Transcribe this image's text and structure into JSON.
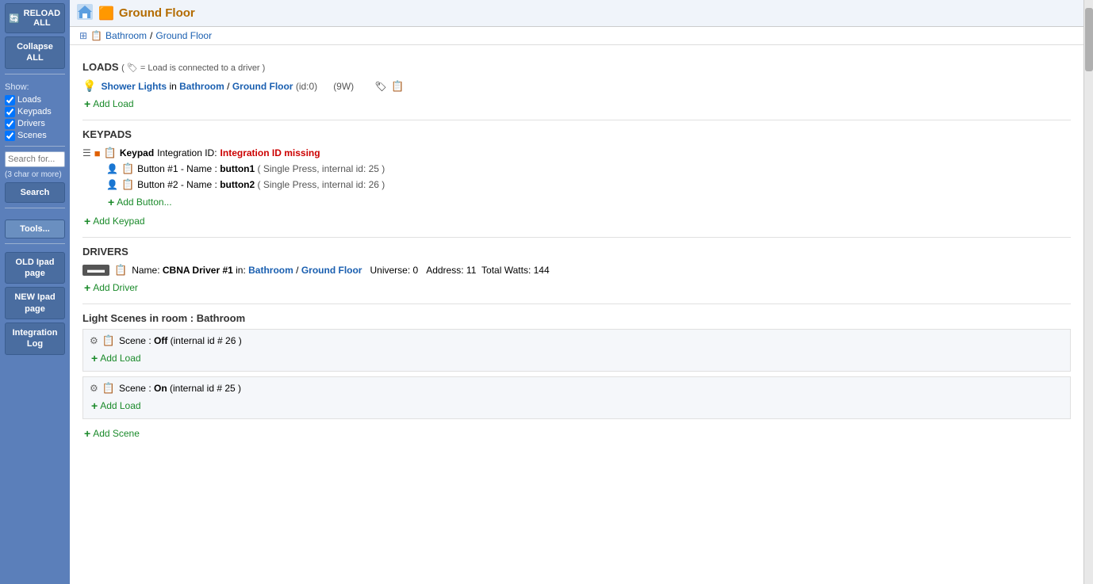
{
  "sidebar": {
    "reload_label": "RELOAD ALL",
    "collapse_label": "Collapse ALL",
    "show_label": "Show:",
    "checkboxes": [
      {
        "id": "cb-loads",
        "label": "Loads",
        "checked": true
      },
      {
        "id": "cb-keypads",
        "label": "Keypads",
        "checked": true
      },
      {
        "id": "cb-drivers",
        "label": "Drivers",
        "checked": true
      },
      {
        "id": "cb-scenes",
        "label": "Scenes",
        "checked": true
      }
    ],
    "search_placeholder": "Search for...",
    "search_hint": "(3 char or more)",
    "search_button": "Search",
    "tools_label": "Tools...",
    "old_ipad_label": "OLD Ipad page",
    "new_ipad_label": "NEW Ipad page",
    "integration_log_label": "Integration Log"
  },
  "titlebar": {
    "icon": "🏠",
    "title": "Ground Floor"
  },
  "breadcrumb": {
    "parts": [
      "Bathroom",
      " / ",
      "Ground Floor"
    ]
  },
  "loads": {
    "section_label": "LOADS",
    "note": "( 🏷 = Load is connected to a driver )",
    "items": [
      {
        "name": "Shower Lights",
        "room": "Bathroom",
        "floor": "Ground Floor",
        "id": "id:0",
        "watts": "(9W)"
      }
    ],
    "add_label": "Add Load"
  },
  "keypads": {
    "section_label": "KEYPADS",
    "items": [
      {
        "icon": "table",
        "color_icon": "orange",
        "label": "Keypad",
        "integration_label": "Integration ID:",
        "error": "Integration ID missing",
        "buttons": [
          {
            "name": "button1",
            "display": "Button #1 - Name : button1",
            "detail": "( Single Press, internal id: 25 )"
          },
          {
            "name": "button2",
            "display": "Button #2 - Name : button2",
            "detail": "( Single Press, internal id: 26 )"
          }
        ],
        "add_button_label": "Add Button..."
      }
    ],
    "add_label": "Add Keypad"
  },
  "drivers": {
    "section_label": "DRIVERS",
    "items": [
      {
        "name": "CBNA Driver #1",
        "room": "Bathroom",
        "floor": "Ground Floor",
        "universe": "0",
        "address": "11",
        "total_watts": "144"
      }
    ],
    "add_label": "Add Driver"
  },
  "scenes": {
    "section_label": "Light Scenes in room : Bathroom",
    "items": [
      {
        "name": "Off",
        "internal_id": "26",
        "add_load_label": "Add Load"
      },
      {
        "name": "On",
        "internal_id": "25",
        "add_load_label": "Add Load"
      }
    ],
    "add_label": "Add Scene"
  },
  "colors": {
    "link": "#1a5fb0",
    "add": "#1a8a2a",
    "error": "#cc0000",
    "orange": "#e06000",
    "title": "#b36b00"
  }
}
